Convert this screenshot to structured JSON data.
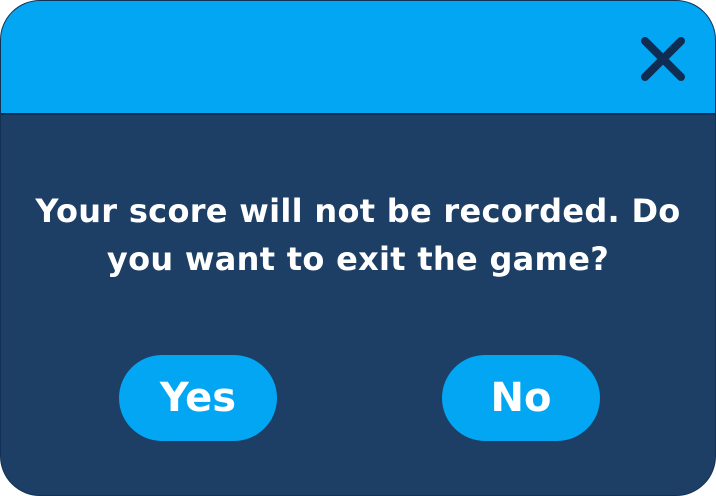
{
  "dialog": {
    "message_line1": "Your score will not be recorded. Do",
    "message_line2": "you want to exit the game?",
    "yes_label": "Yes",
    "no_label": "No",
    "close_icon": "close-icon"
  },
  "colors": {
    "header": "#03a6f3",
    "body": "#1d3f66",
    "button": "#03a6f3",
    "close_icon": "#0f2d52",
    "text": "#ffffff"
  }
}
